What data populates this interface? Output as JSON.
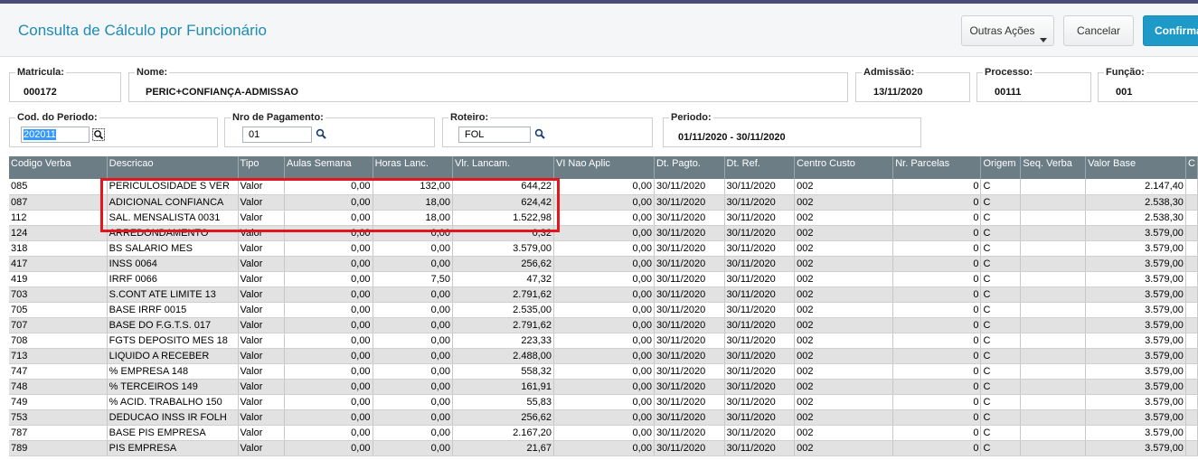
{
  "header": {
    "title": "Consulta de Cálculo por Funcionário",
    "buttons": {
      "outras": "Outras Ações",
      "cancelar": "Cancelar",
      "confirmar": "Confirmar"
    }
  },
  "fields": {
    "matricula": {
      "label": "Matricula:",
      "value": "000172"
    },
    "nome": {
      "label": "Nome:",
      "value": "PERIC+CONFIANÇA-ADMISSAO"
    },
    "admissao": {
      "label": "Admissão:",
      "value": "13/11/2020"
    },
    "processo": {
      "label": "Processo:",
      "value": "00111"
    },
    "funcao": {
      "label": "Função:",
      "value": "001"
    },
    "cod_periodo": {
      "label": "Cod. do Periodo:",
      "value": "202011"
    },
    "nro_pagamento": {
      "label": "Nro de Pagamento:",
      "value": "01"
    },
    "roteiro": {
      "label": "Roteiro:",
      "value": "FOL"
    },
    "periodo": {
      "label": "Periodo:",
      "value": "01/11/2020 - 30/11/2020"
    }
  },
  "table": {
    "columns": [
      "Codigo Verba",
      "Descricao",
      "Tipo",
      "Aulas Semana",
      "Horas Lanc.",
      "Vlr. Lancam.",
      "VI Nao Aplic",
      "Dt. Pagto.",
      "Dt. Ref.",
      "Centro Custo",
      "Nr. Parcelas",
      "Origem",
      "Seq. Verba",
      "Valor Base",
      "C"
    ],
    "rows": [
      [
        "085",
        "PERICULOSIDADE S VER",
        "Valor",
        "0,00",
        "132,00",
        "644,22",
        "0,00",
        "30/11/2020",
        "30/11/2020",
        "002",
        "0",
        "C",
        "",
        "2.147,40",
        ""
      ],
      [
        "087",
        "ADICIONAL CONFIANCA",
        "Valor",
        "0,00",
        "18,00",
        "624,42",
        "0,00",
        "30/11/2020",
        "30/11/2020",
        "002",
        "0",
        "C",
        "",
        "2.538,30",
        ""
      ],
      [
        "112",
        "SAL. MENSALISTA 0031",
        "Valor",
        "0,00",
        "18,00",
        "1.522,98",
        "0,00",
        "30/11/2020",
        "30/11/2020",
        "002",
        "0",
        "C",
        "",
        "2.538,30",
        ""
      ],
      [
        "124",
        "ARREDONDAMENTO",
        "Valor",
        "0,00",
        "0,00",
        "0,32",
        "0,00",
        "30/11/2020",
        "30/11/2020",
        "002",
        "0",
        "C",
        "",
        "3.579,00",
        ""
      ],
      [
        "318",
        "BS SALARIO MES",
        "Valor",
        "0,00",
        "0,00",
        "3.579,00",
        "0,00",
        "30/11/2020",
        "30/11/2020",
        "002",
        "0",
        "C",
        "",
        "3.579,00",
        ""
      ],
      [
        "417",
        "INSS 0064",
        "Valor",
        "0,00",
        "0,00",
        "256,62",
        "0,00",
        "30/11/2020",
        "30/11/2020",
        "002",
        "0",
        "C",
        "",
        "3.579,00",
        ""
      ],
      [
        "419",
        "IRRF 0066",
        "Valor",
        "0,00",
        "7,50",
        "47,32",
        "0,00",
        "30/11/2020",
        "30/11/2020",
        "002",
        "0",
        "C",
        "",
        "3.579,00",
        ""
      ],
      [
        "703",
        "S.CONT ATE LIMITE 13",
        "Valor",
        "0,00",
        "0,00",
        "2.791,62",
        "0,00",
        "30/11/2020",
        "30/11/2020",
        "002",
        "0",
        "C",
        "",
        "3.579,00",
        ""
      ],
      [
        "705",
        "BASE IRRF 0015",
        "Valor",
        "0,00",
        "0,00",
        "2.535,00",
        "0,00",
        "30/11/2020",
        "30/11/2020",
        "002",
        "0",
        "C",
        "",
        "3.579,00",
        ""
      ],
      [
        "707",
        "BASE DO F.G.T.S. 017",
        "Valor",
        "0,00",
        "0,00",
        "2.791,62",
        "0,00",
        "30/11/2020",
        "30/11/2020",
        "002",
        "0",
        "C",
        "",
        "3.579,00",
        ""
      ],
      [
        "708",
        "FGTS DEPOSITO MES 18",
        "Valor",
        "0,00",
        "0,00",
        "223,33",
        "0,00",
        "30/11/2020",
        "30/11/2020",
        "002",
        "0",
        "C",
        "",
        "3.579,00",
        ""
      ],
      [
        "713",
        "LIQUIDO A RECEBER",
        "Valor",
        "0,00",
        "0,00",
        "2.488,00",
        "0,00",
        "30/11/2020",
        "30/11/2020",
        "002",
        "0",
        "C",
        "",
        "3.579,00",
        ""
      ],
      [
        "747",
        "% EMPRESA  148",
        "Valor",
        "0,00",
        "0,00",
        "558,32",
        "0,00",
        "30/11/2020",
        "30/11/2020",
        "002",
        "0",
        "C",
        "",
        "3.579,00",
        ""
      ],
      [
        "748",
        "% TERCEIROS 149",
        "Valor",
        "0,00",
        "0,00",
        "161,91",
        "0,00",
        "30/11/2020",
        "30/11/2020",
        "002",
        "0",
        "C",
        "",
        "3.579,00",
        ""
      ],
      [
        "749",
        "% ACID. TRABALHO 150",
        "Valor",
        "0,00",
        "0,00",
        "55,83",
        "0,00",
        "30/11/2020",
        "30/11/2020",
        "002",
        "0",
        "C",
        "",
        "3.579,00",
        ""
      ],
      [
        "753",
        "DEDUCAO INSS IR FOLH",
        "Valor",
        "0,00",
        "0,00",
        "256,62",
        "0,00",
        "30/11/2020",
        "30/11/2020",
        "002",
        "0",
        "C",
        "",
        "3.579,00",
        ""
      ],
      [
        "787",
        "BASE PIS EMPRESA",
        "Valor",
        "0,00",
        "0,00",
        "2.167,20",
        "0,00",
        "30/11/2020",
        "30/11/2020",
        "002",
        "0",
        "C",
        "",
        "3.579,00",
        ""
      ],
      [
        "789",
        "PIS EMPRESA",
        "Valor",
        "0,00",
        "0,00",
        "21,67",
        "0,00",
        "30/11/2020",
        "30/11/2020",
        "002",
        "0",
        "C",
        "",
        "3.579,00",
        ""
      ]
    ]
  },
  "icons": {
    "lookup": "magnifier-icon",
    "dropdown": "caret-down-icon"
  },
  "colors": {
    "accent": "#1d9ac7",
    "title": "#1c8bb5",
    "grid_header": "#6c7d85",
    "highlight": "#e2161c"
  }
}
